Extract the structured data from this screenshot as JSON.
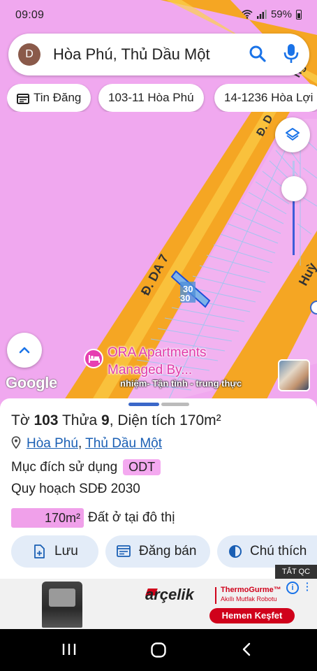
{
  "status_bar": {
    "time": "09:09",
    "battery": "59%"
  },
  "search": {
    "avatar_letter": "D",
    "query": "Hòa Phú, Thủ Dầu Một"
  },
  "chips": [
    {
      "label": "Tin Đăng"
    },
    {
      "label": "103-11 Hòa Phú"
    },
    {
      "label": "14-1236 Hòa Lợi"
    }
  ],
  "map": {
    "google_logo": "Google",
    "street_label": "Đ. DA 7",
    "street_label_2": "Đ. D",
    "street_label_3": "Huỳ",
    "street_label_4": "ng",
    "plot_number": "30",
    "plot_number_2": "30",
    "poi_name_line1": "ORA Apartments",
    "poi_name_line2": "Managed By...",
    "ad_caption": "nhiệm- Tận tình - trung thực",
    "colors": {
      "land": "#f0a8ef",
      "road": "#f5a623",
      "road_edge": "#fbd34d",
      "plot_highlight": "#7fb3e8",
      "poi": "#e63fb1"
    }
  },
  "parcel": {
    "sheet_prefix": "Tờ ",
    "sheet_no": "103",
    "lot_prefix": " Thửa ",
    "lot_no": "9",
    "area_prefix": ", Diện tích ",
    "area_value": "170m²",
    "ward_link": "Hòa Phú",
    "separator": ",",
    "city_link": "Thủ Dầu Một",
    "purpose_label": "Mục đích sử dụng",
    "purpose_code": "ODT",
    "plan_label": "Quy hoạch SDĐ 2030",
    "plan_area": "170m²",
    "plan_desc": "Đất ở tại đô thị"
  },
  "actions": {
    "save": "Lưu",
    "sell": "Đăng bán",
    "legend": "Chú thích"
  },
  "ad": {
    "close_label": "TẮT QC",
    "brand": "arçelik",
    "product_line1": "ThermoGurme™",
    "product_line2": "Akıllı Mutfak Robotu",
    "cta": "Hemen Keşfet",
    "info": "i"
  },
  "icons": [
    "wifi-icon",
    "signal-icon",
    "battery-icon",
    "search-icon",
    "mic-icon",
    "calendar-list-icon",
    "layers-icon",
    "chevron-up-icon",
    "hotel-icon",
    "pin-icon",
    "add-file-icon",
    "listing-icon",
    "contrast-icon",
    "recents-icon",
    "home-icon",
    "back-icon"
  ]
}
